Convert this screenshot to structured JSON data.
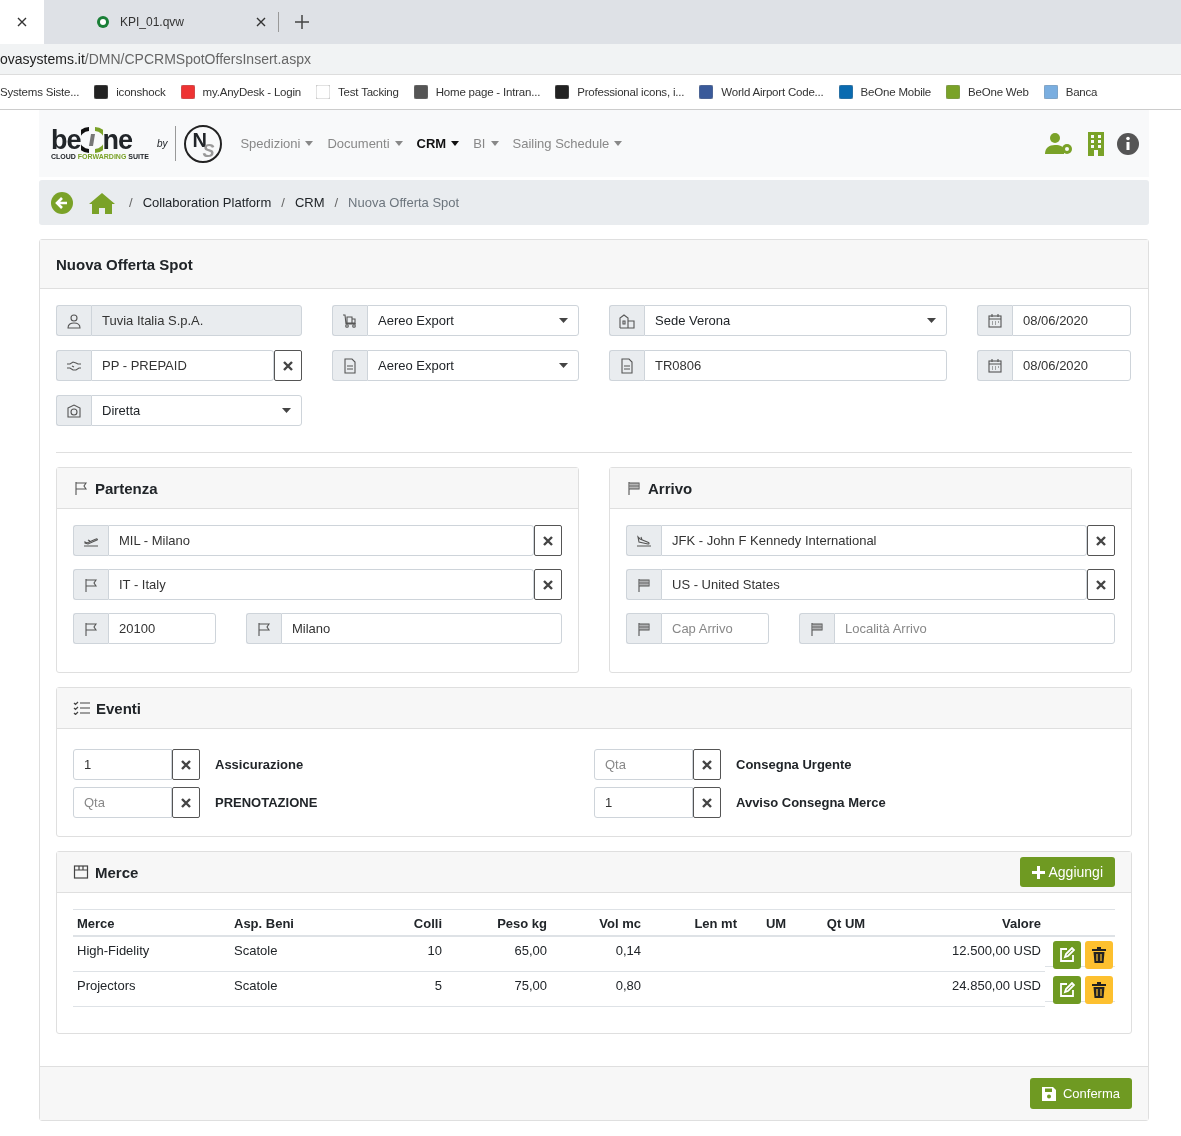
{
  "browser": {
    "tabs": [
      {
        "selected": true
      },
      {
        "title": "KPI_01.qvw",
        "selected": false
      }
    ],
    "url_host": "ovasystems.it",
    "url_path": "/DMN/CPCRMSpotOffersInsert.aspx",
    "bookmarks": [
      "Systems Siste...",
      "iconshock",
      "my.AnyDesk - Login",
      "Test Tacking",
      "Home page - Intran...",
      "Professional icons, i...",
      "World Airport Code...",
      "BeOne Mobile",
      "BeOne Web",
      "Banca"
    ]
  },
  "nav": {
    "logo": {
      "word_start": "be",
      "word_end": "ne",
      "tagline_start": "CLOUD ",
      "tagline_mid": "FORWARDING",
      "tagline_end": " SUITE",
      "by": "by",
      "mark_n": "N",
      "mark_s": "S"
    },
    "menu": [
      {
        "label": "Spedizioni",
        "selected": false
      },
      {
        "label": "Documenti",
        "selected": false
      },
      {
        "label": "CRM",
        "selected": true
      },
      {
        "label": "BI",
        "selected": false
      },
      {
        "label": "Sailing Schedule",
        "selected": false
      }
    ]
  },
  "breadcrumb": [
    {
      "separator": "/",
      "label": "Collaboration Platform",
      "current": false
    },
    {
      "separator": "/",
      "label": "CRM",
      "current": false
    },
    {
      "separator": "/",
      "label": "Nuova Offerta Spot",
      "current": true
    }
  ],
  "form": {
    "title": "Nuova Offerta Spot",
    "fields": [
      {
        "kind": "readonly",
        "value": "Tuvia Italia S.p.A."
      },
      {
        "kind": "select",
        "value": "Aereo Export"
      },
      {
        "kind": "select",
        "value": "Sede Verona"
      },
      {
        "kind": "text",
        "value": "08/06/2020"
      },
      {
        "kind": "clear",
        "value": "PP - PREPAID"
      },
      {
        "kind": "select",
        "value": "Aereo Export"
      },
      {
        "kind": "text",
        "value": "TR0806"
      },
      {
        "kind": "text",
        "value": "08/06/2020"
      },
      {
        "kind": "select",
        "value": "Diretta"
      }
    ],
    "departure": {
      "title": "Partenza",
      "fields": [
        {
          "kind": "clear",
          "value": "MIL - Milano"
        },
        {
          "kind": "clear",
          "value": "IT - Italy"
        },
        {
          "kind": "text",
          "value": "20100"
        },
        {
          "kind": "text",
          "value": "Milano"
        }
      ]
    },
    "arrival": {
      "title": "Arrivo",
      "fields": [
        {
          "kind": "clear",
          "value": "JFK - John F Kennedy International"
        },
        {
          "kind": "clear",
          "value": "US - United States"
        },
        {
          "kind": "text",
          "placeholder": "Cap Arrivo"
        },
        {
          "kind": "text",
          "placeholder": "Località Arrivo"
        }
      ]
    },
    "events": {
      "title": "Eventi",
      "items": [
        {
          "quantity": "1",
          "name": "Assicurazione"
        },
        {
          "placeholder": "Qta",
          "name": "PRENOTAZIONE"
        },
        {
          "placeholder": "Qta",
          "name": "Consegna Urgente"
        },
        {
          "quantity": "1",
          "name": "Avviso Consegna Merce"
        }
      ]
    },
    "goods": {
      "title": "Merce",
      "add_button": "Aggiungi",
      "columns": [
        "Merce",
        "Asp. Beni",
        "Colli",
        "Peso kg",
        "Vol mc",
        "Len mt",
        "UM",
        "Qt UM",
        "Valore"
      ],
      "rows": [
        [
          "High-Fidelity",
          "Scatole",
          "10",
          "65,00",
          "0,14",
          "",
          "",
          "",
          "12.500,00 USD"
        ],
        [
          "Projectors",
          "Scatole",
          "5",
          "75,00",
          "0,80",
          "",
          "",
          "",
          "24.850,00 USD"
        ]
      ]
    },
    "confirm_button": "Conferma"
  }
}
